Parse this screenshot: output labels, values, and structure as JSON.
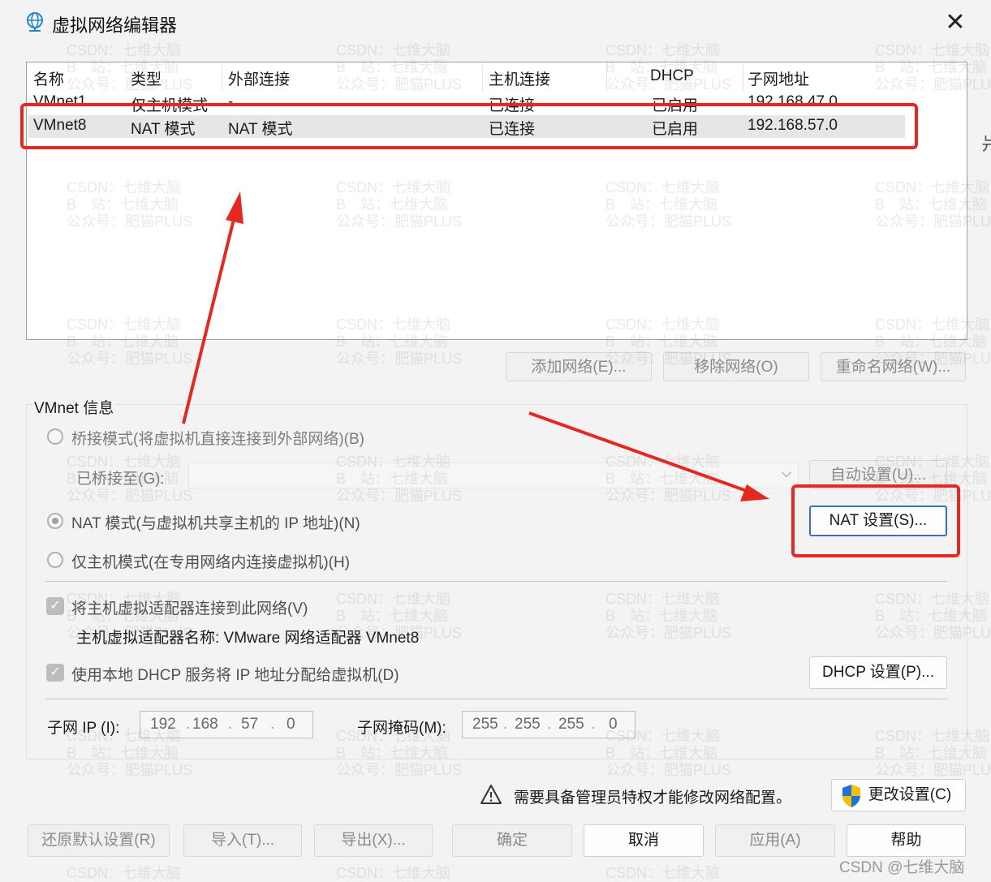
{
  "title": "虚拟网络编辑器",
  "list": {
    "columns": [
      "名称",
      "类型",
      "外部连接",
      "主机连接",
      "DHCP",
      "子网地址"
    ],
    "rows": [
      {
        "name": "VMnet1",
        "type": "仅主机模式",
        "external": "-",
        "host": "已连接",
        "dhcp": "已启用",
        "subnet": "192.168.47.0"
      },
      {
        "name": "VMnet8",
        "type": "NAT 模式",
        "external": "NAT 模式",
        "host": "已连接",
        "dhcp": "已启用",
        "subnet": "192.168.57.0"
      }
    ],
    "selected_row": 1
  },
  "list_buttons": {
    "add": "添加网络(E)...",
    "remove": "移除网络(O)",
    "rename": "重命名网络(W)..."
  },
  "info": {
    "group_label": "VMnet 信息",
    "bridged_label": "桥接模式(将虚拟机直接连接到外部网络)(B)",
    "bridged_to_label": "已桥接至(G):",
    "auto_button": "自动设置(U)...",
    "nat_label": "NAT 模式(与虚拟机共享主机的 IP 地址)(N)",
    "nat_settings_button": "NAT 设置(S)...",
    "hostonly_label": "仅主机模式(在专用网络内连接虚拟机)(H)",
    "connect_adapter_label": "将主机虚拟适配器连接到此网络(V)",
    "adapter_name_label": "主机虚拟适配器名称: VMware 网络适配器 VMnet8",
    "dhcp_label": "使用本地 DHCP 服务将 IP 地址分配给虚拟机(D)",
    "dhcp_button": "DHCP 设置(P)...",
    "subnet_ip_label": "子网 IP (I):",
    "subnet_ip": [
      "192",
      "168",
      "57",
      "0"
    ],
    "subnet_mask_label": "子网掩码(M):",
    "subnet_mask": [
      "255",
      "255",
      "255",
      "0"
    ],
    "selected_mode": "nat"
  },
  "admin": {
    "warning_text": "需要具备管理员特权才能修改网络配置。",
    "change_button": "更改设置(C)"
  },
  "bottom_buttons": {
    "restore": "还原默认设置(R)",
    "import": "导入(T)...",
    "export": "导出(X)...",
    "ok": "确定",
    "cancel": "取消",
    "apply": "应用(A)",
    "help": "帮助"
  },
  "watermark": {
    "line1": "CSDN：七维大脑",
    "line2": "B　站：七维大脑",
    "line3": "公众号：肥猫PLUS",
    "footer": "CSDN @七维大脑"
  },
  "colors": {
    "annotation_red": "#e42a20",
    "default_button_border": "#3b6fc4",
    "shield_blue": "#1e73d8",
    "shield_yellow": "#f2c200"
  }
}
